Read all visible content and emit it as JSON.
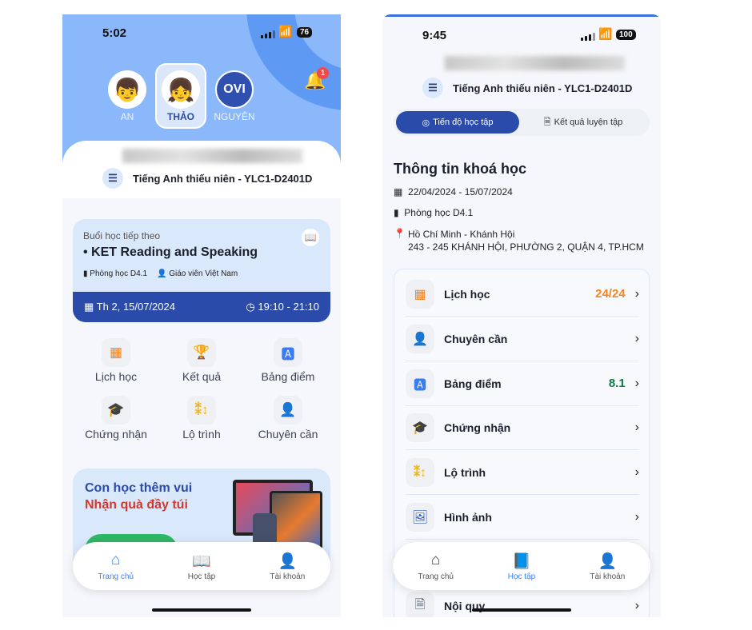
{
  "left": {
    "status": {
      "time": "5:02",
      "battery": "76"
    },
    "profiles": [
      {
        "name": "AN",
        "active": false
      },
      {
        "name": "THẢO",
        "active": true
      },
      {
        "name": "NGUYÊN",
        "logo": "OVI",
        "active": false
      }
    ],
    "notification_count": "1",
    "course": "Tiếng Anh thiếu niên - YLC1-D2401D",
    "next_lesson": {
      "label": "Buổi học tiếp theo",
      "title": "• KET Reading and Speaking",
      "room": "Phòng học D4.1",
      "teacher": "Giáo viên Việt Nam",
      "date": "Th 2, 15/07/2024",
      "time": "19:10 - 21:10"
    },
    "grid": [
      {
        "label": "Lịch học",
        "icon": "calendar-icon",
        "color": "#f5831f"
      },
      {
        "label": "Kết quả",
        "icon": "trophy-icon",
        "color": "#2fb865"
      },
      {
        "label": "Bảng điểm",
        "icon": "report-icon",
        "color": "#3b7cf0"
      },
      {
        "label": "Chứng nhận",
        "icon": "graduation-cap-icon",
        "color": "#c8322a"
      },
      {
        "label": "Lộ trình",
        "icon": "roadmap-icon",
        "color": "#f2b614"
      },
      {
        "label": "Chuyên cần",
        "icon": "attendance-icon",
        "color": "#2fb865"
      }
    ],
    "promo": {
      "line1": "Con học thêm vui",
      "line2": "Nhận quà đầy túi"
    },
    "nav": [
      {
        "label": "Trang chủ",
        "active": true
      },
      {
        "label": "Học tập",
        "active": false
      },
      {
        "label": "Tài khoản",
        "active": false
      }
    ]
  },
  "right": {
    "status": {
      "time": "9:45",
      "battery": "100"
    },
    "course": "Tiếng Anh thiếu niên - YLC1-D2401D",
    "tabs": [
      {
        "label": "Tiến độ học tập",
        "active": true
      },
      {
        "label": "Kết quả luyện tập",
        "active": false
      }
    ],
    "info": {
      "title": "Thông tin khoá học",
      "dates": "22/04/2024 - 15/07/2024",
      "room": "Phòng học D4.1",
      "location": "Hồ Chí Minh - Khánh Hội",
      "address": "243 - 245 KHÁNH HỘI, PHƯỜNG 2, QUẬN 4, TP.HCM"
    },
    "rows": [
      {
        "label": "Lịch học",
        "value": "24/24",
        "value_color": "#f5831f",
        "icon": "calendar-icon",
        "color": "#f5831f"
      },
      {
        "label": "Chuyên cần",
        "value": "",
        "icon": "attendance-icon",
        "color": "#2fb865"
      },
      {
        "label": "Bảng điểm",
        "value": "8.1",
        "value_color": "#117a45",
        "icon": "report-icon",
        "color": "#3b7cf0"
      },
      {
        "label": "Chứng nhận",
        "value": "",
        "icon": "graduation-cap-icon",
        "color": "#c8322a"
      },
      {
        "label": "Lộ trình",
        "value": "",
        "icon": "roadmap-icon",
        "color": "#f2b614"
      },
      {
        "label": "Hình ảnh",
        "value": "",
        "icon": "image-icon",
        "color": "#2d5bd0"
      },
      {
        "label": "Nội quy",
        "value": "",
        "icon": "document-icon",
        "color": "#4a5263"
      }
    ],
    "nav": [
      {
        "label": "Trang chủ",
        "active": false
      },
      {
        "label": "Học tập",
        "active": true
      },
      {
        "label": "Tài khoản",
        "active": false
      }
    ]
  }
}
